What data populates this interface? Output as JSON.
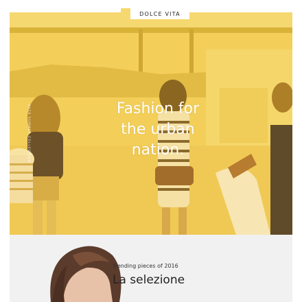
{
  "brand": {
    "logo_text": "DOLCE VITA"
  },
  "hero": {
    "title": "Fashion for\nthe urban\nnation.",
    "side_text": "2016 SUMMER COLLECTION",
    "slides": {
      "count": 4,
      "active": 0
    },
    "overlay_color": "#f2c94c"
  },
  "section": {
    "kicker": "Trending pieces of 2016",
    "title": "La selezione"
  },
  "colors": {
    "accent_yellow": "#f2c94c",
    "section_bg": "#f1f1f1",
    "text_dark": "#222222"
  }
}
